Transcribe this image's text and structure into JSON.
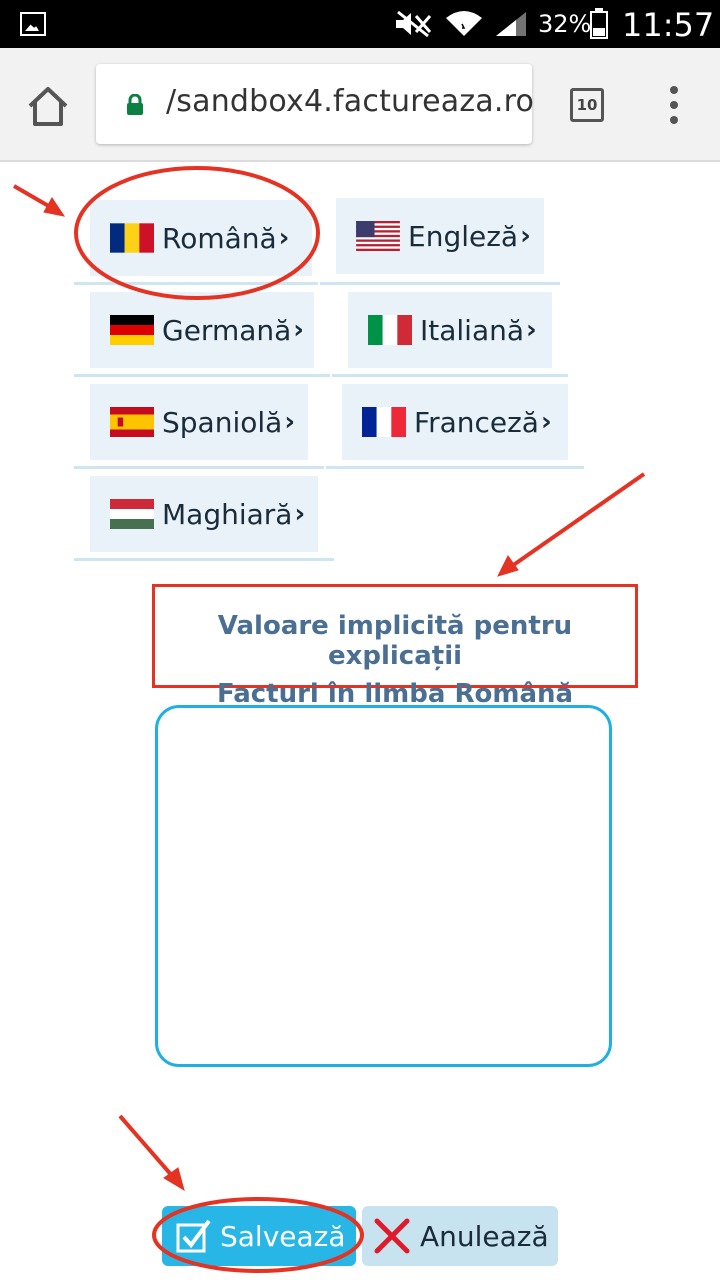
{
  "status_bar": {
    "battery": "32%",
    "time": "11:57"
  },
  "browser": {
    "url": "/sandbox4.factureaza.ro",
    "tab_count": "10"
  },
  "languages": [
    {
      "label": "Română",
      "flag": "ro"
    },
    {
      "label": "Engleză",
      "flag": "us"
    },
    {
      "label": "Germană",
      "flag": "de"
    },
    {
      "label": "Italiană",
      "flag": "it"
    },
    {
      "label": "Spaniolă",
      "flag": "es"
    },
    {
      "label": "Franceză",
      "flag": "fr"
    },
    {
      "label": "Maghiară",
      "flag": "hu"
    }
  ],
  "chevron": "›",
  "description": {
    "line1": "Valoare implicită pentru explicații",
    "line2": "Facturi în limba Română"
  },
  "explanation_text": "",
  "actions": {
    "save_label": "Salvează",
    "cancel_label": "Anulează"
  },
  "colors": {
    "accent": "#27b6e6",
    "annotation": "#e53323",
    "heading": "#4a6f92"
  }
}
